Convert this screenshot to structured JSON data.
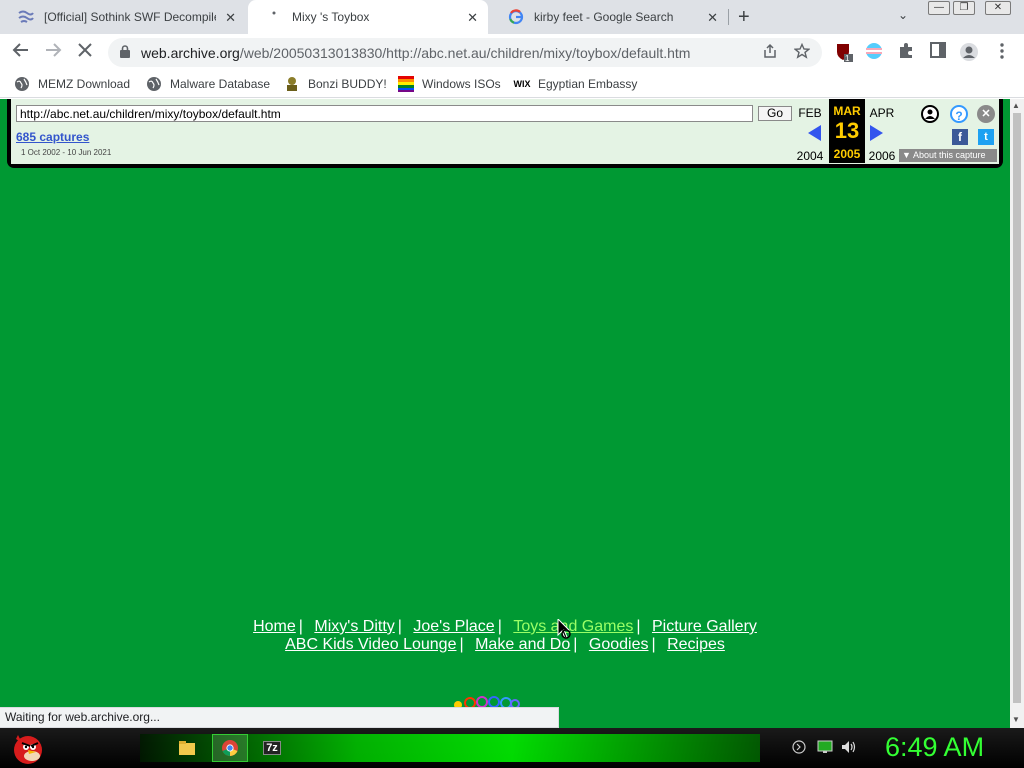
{
  "browser": {
    "tabs": [
      {
        "title": "[Official] Sothink SWF Decompile",
        "icon": "sothink-icon",
        "active": false
      },
      {
        "title": "Mixy 's Toybox",
        "icon": "loading-icon",
        "active": true
      },
      {
        "title": "kirby feet - Google Search",
        "icon": "google-icon",
        "active": false
      }
    ],
    "close_glyph": "✕",
    "newtab_glyph": "+",
    "tablist_glyph": "⌄",
    "window_buttons": [
      "—",
      "❐",
      "✕"
    ],
    "url_host": "web.archive.org",
    "url_path": "/web/20050313013830/http://abc.net.au/children/mixy/toybox/default.htm",
    "extension_badge": "1"
  },
  "bookmarks": [
    {
      "label": "MEMZ Download",
      "icon": "globe-icon"
    },
    {
      "label": "Malware Database",
      "icon": "globe-icon"
    },
    {
      "label": "Bonzi BUDDY!",
      "icon": "bonzi-icon"
    },
    {
      "label": "Windows ISOs",
      "icon": "windows-flag-icon"
    },
    {
      "label": "Egyptian Embassy",
      "icon": "wix-icon",
      "icon_text": "WIX"
    }
  ],
  "wayback": {
    "url_value": "http://abc.net.au/children/mixy/toybox/default.htm",
    "go_label": "Go",
    "captures_label": "685 captures",
    "date_range": "1 Oct 2002 - 10 Jun 2021",
    "prev_month": "FEB",
    "prev_year": "2004",
    "cur_month": "MAR",
    "cur_day": "13",
    "cur_year": "2005",
    "next_month": "APR",
    "next_year": "2006",
    "about_label": "About this capture",
    "about_arrow": "▼",
    "help_glyph": "?",
    "close_glyph": "✕",
    "facebook_glyph": "f",
    "twitter_glyph": "t",
    "colors": {
      "highlight": "#ffcc00",
      "link": "#3355cc",
      "bar_bg": "#e4f3e4"
    }
  },
  "page": {
    "background": "#009933",
    "nav_row1": [
      {
        "label": "Home",
        "highlight": false
      },
      {
        "label": "Mixy's Ditty",
        "highlight": false
      },
      {
        "label": "Joe's Place",
        "highlight": false
      },
      {
        "label": "Toys and Games",
        "highlight": true
      },
      {
        "label": "Picture Gallery",
        "highlight": false
      }
    ],
    "nav_row2": [
      {
        "label": "ABC Kids Video Lounge"
      },
      {
        "label": "Make and Do"
      },
      {
        "label": "Goodies"
      },
      {
        "label": "Recipes"
      }
    ],
    "separator": "|"
  },
  "status_text": "Waiting for web.archive.org...",
  "taskbar": {
    "clock": "6:49 AM",
    "apps": [
      "file-explorer-icon",
      "chrome-icon",
      "7zip-icon"
    ],
    "sevenzip_text": "7z",
    "tray": [
      "notification-icon",
      "network-icon",
      "volume-icon"
    ]
  }
}
